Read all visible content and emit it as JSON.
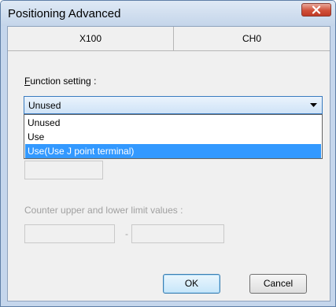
{
  "window": {
    "title": "Positioning Advanced"
  },
  "header": {
    "cells": [
      "X100",
      "CH0"
    ]
  },
  "function_setting": {
    "label": "Function setting :",
    "label_accesskey": "F",
    "label_rest": "unction setting :",
    "selected": "Unused",
    "options": [
      "Unused",
      "Use",
      "Use(Use J point terminal)"
    ],
    "highlighted_index": 2
  },
  "counter_limits": {
    "label": "Counter upper and lower limit values :",
    "separator": "-"
  },
  "buttons": {
    "ok": "OK",
    "cancel": "Cancel"
  },
  "colors": {
    "highlight": "#3399ff",
    "close": "#c7452f",
    "title_bg": "#c5d6ec"
  },
  "icons": {
    "close": "close-icon",
    "dropdown": "chevron-down-icon"
  }
}
